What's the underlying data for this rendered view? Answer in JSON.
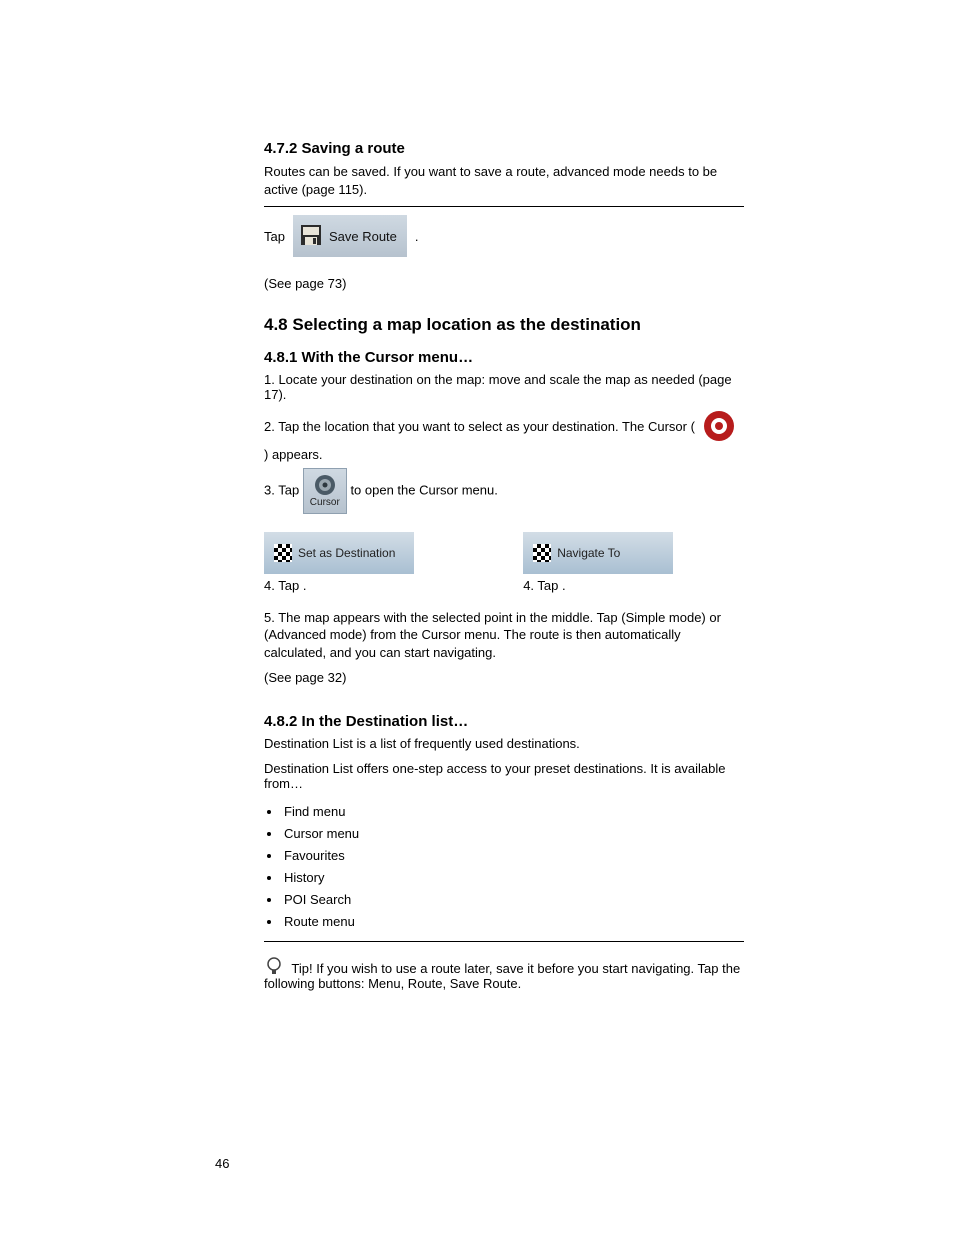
{
  "section1": {
    "title": "4.7.2 Saving a route",
    "body": "Routes can be saved. If you want to save a route, advanced mode needs to be active (page 115).",
    "tap_prefix": "Tap",
    "tap_suffix": ".",
    "save_route_button_label": "Save Route",
    "section_ref": "(See page 73)"
  },
  "section2": {
    "title": "4.8 Selecting a map location as the destination",
    "sub": "4.8.1 With the Cursor menu…",
    "step1_a": "1. Locate your destination on the map: move and scale the map as needed (page 17).",
    "cursor_marker_alt": "map cursor marker",
    "step2_a": "2. Tap the location that you want to select as your destination. The Cursor (",
    "step2_b": ") appears.",
    "step3_a": "3. Tap",
    "cursor_button_label": "Cursor",
    "step3_b": "to open the Cursor menu.",
    "left_btn_prefix": "4. Tap",
    "left_btn_label": "Set as Destination",
    "left_btn_suffix": ".",
    "right_btn_prefix": "4. Tap",
    "right_btn_label": "Navigate To",
    "right_btn_suffix": ".",
    "route_summary": "5. The map appears with the selected point in the middle. Tap (Simple mode) or (Advanced mode) from the Cursor menu. The route is then automatically calculated, and you can start navigating.",
    "see_page": "(See page 32)"
  },
  "section3": {
    "h3": "4.8.2 In the Destination list…",
    "d1": "Destination List is a list of frequently used destinations.",
    "d2": "Destination List offers one-step access to your preset destinations. It is available from…",
    "items": [
      "Find menu",
      "Cursor menu",
      "Favourites",
      "History",
      "POI Search",
      "Route menu"
    ],
    "tip_label": "Tip!",
    "tip_text": "If you wish to use a route later, save it before you start navigating. Tap the following buttons: Menu, Route, Save Route."
  },
  "page_number": "46"
}
